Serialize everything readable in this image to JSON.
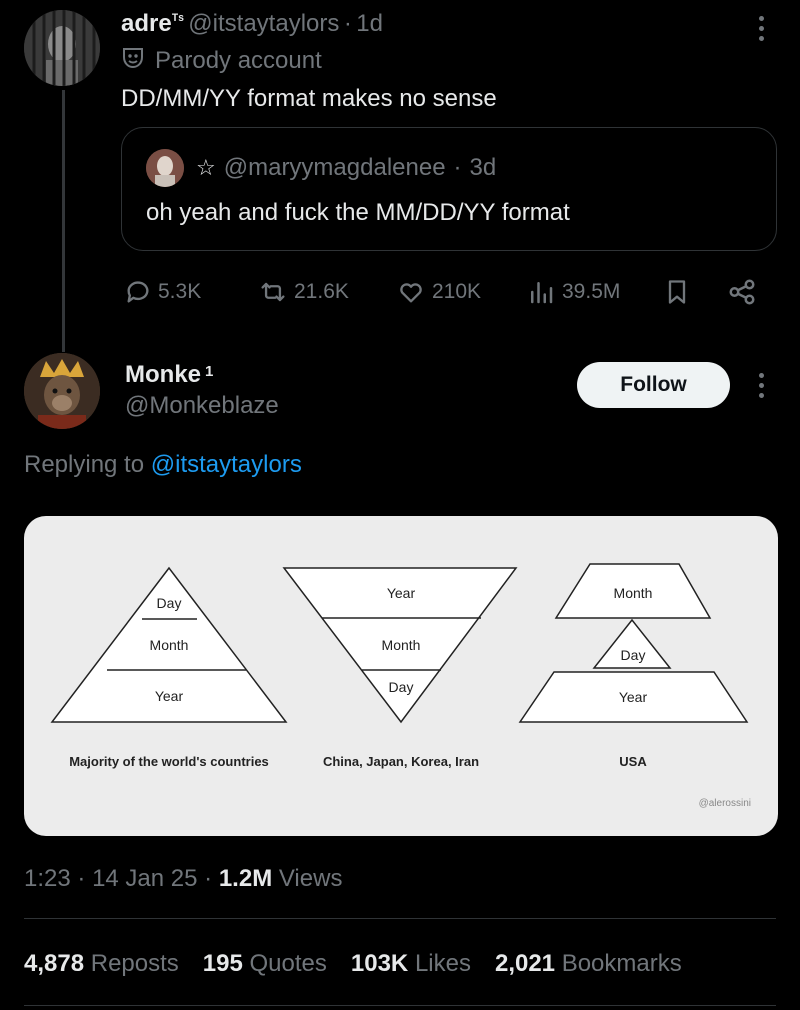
{
  "tweet": {
    "author_name": "adre",
    "author_badge": "ᵀˢ",
    "author_handle": "@itstaytaylors",
    "separator": "·",
    "time": "1d",
    "label": "Parody account",
    "text": "DD/MM/YY format makes no sense"
  },
  "quote": {
    "handle": "@maryymagdalenee",
    "separator": "·",
    "time": "3d",
    "text": "oh yeah and fuck the MM/DD/YY format"
  },
  "actions": {
    "replies": "5.3K",
    "reposts": "21.6K",
    "likes": "210K",
    "views": "39.5M"
  },
  "reply": {
    "author_name": "Monke",
    "author_badge": "1",
    "author_handle": "@Monkeblaze",
    "follow_label": "Follow",
    "replying_prefix": "Replying to",
    "replying_handle": "@itstaytaylors"
  },
  "image": {
    "pyramids": [
      {
        "labels": [
          "Day",
          "Month",
          "Year"
        ],
        "caption": "Majority of the world's countries"
      },
      {
        "labels": [
          "Year",
          "Month",
          "Day"
        ],
        "caption": "China, Japan, Korea, Iran"
      },
      {
        "labels": [
          "Month",
          "Day",
          "Year"
        ],
        "caption": "USA"
      }
    ],
    "credit": "@alerossini"
  },
  "meta": {
    "time": "1:23",
    "sep1": "·",
    "date": "14 Jan 25",
    "sep2": "·",
    "views_count": "1.2M",
    "views_label": "Views"
  },
  "stats": {
    "reposts_count": "4,878",
    "reposts_label": "Reposts",
    "quotes_count": "195",
    "quotes_label": "Quotes",
    "likes_count": "103K",
    "likes_label": "Likes",
    "bookmarks_count": "2,021",
    "bookmarks_label": "Bookmarks"
  },
  "colors": {
    "background": "#000000",
    "text": "#e7e9ea",
    "muted": "#71767b",
    "link": "#1d9bf0",
    "border": "#2f3336"
  }
}
